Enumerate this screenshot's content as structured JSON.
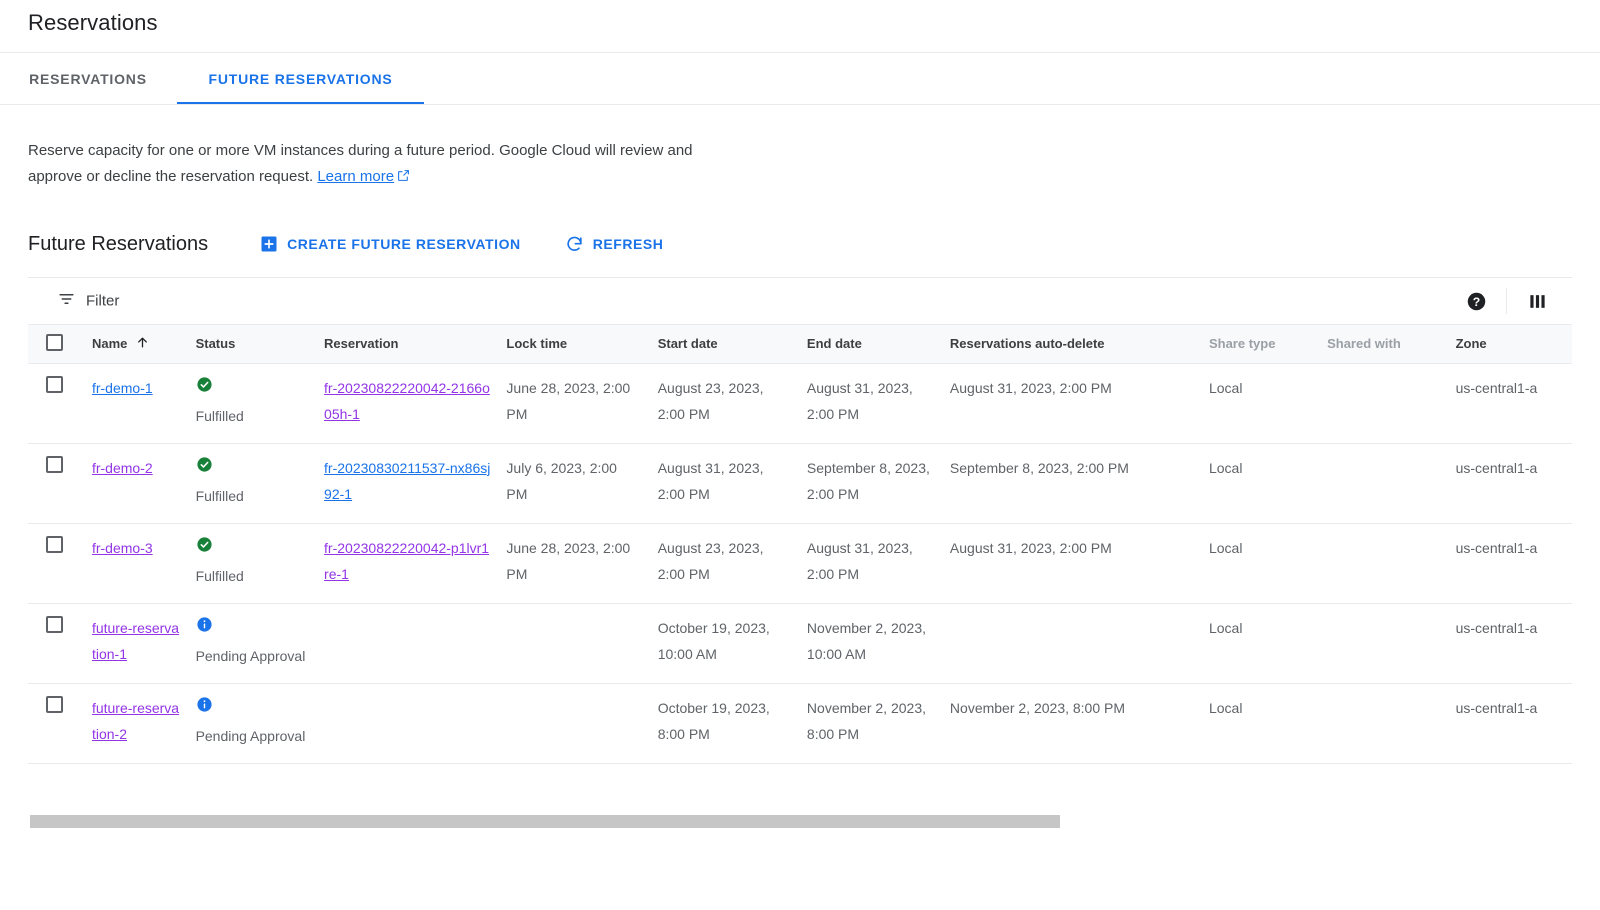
{
  "page": {
    "title": "Reservations"
  },
  "tabs": [
    {
      "label": "RESERVATIONS",
      "selected": false
    },
    {
      "label": "FUTURE RESERVATIONS",
      "selected": true
    }
  ],
  "description": {
    "text": "Reserve capacity for one or more VM instances during a future period. Google Cloud will review and approve or decline the reservation request.",
    "link_label": "Learn more",
    "link_icon": "open-in-new-icon"
  },
  "section": {
    "title": "Future Reservations",
    "create_label": "CREATE FUTURE RESERVATION",
    "create_icon": "add-box-icon",
    "refresh_label": "REFRESH",
    "refresh_icon": "refresh-icon"
  },
  "filter_bar": {
    "filter_label": "Filter",
    "filter_icon": "filter-list-icon",
    "filter_placeholder": "Filter",
    "help_icon": "help-icon",
    "columns_icon": "column-settings-icon"
  },
  "table": {
    "sort_column": "Name",
    "sort_direction": "ascending",
    "sort_icon": "arrow-up-icon",
    "select_all_checkbox": "unchecked",
    "columns": [
      {
        "key": "checkbox",
        "label": ""
      },
      {
        "key": "name",
        "label": "Name",
        "dim": false
      },
      {
        "key": "status",
        "label": "Status",
        "dim": false
      },
      {
        "key": "reservation",
        "label": "Reservation",
        "dim": false
      },
      {
        "key": "lock_time",
        "label": "Lock time",
        "dim": false
      },
      {
        "key": "start_date",
        "label": "Start date",
        "dim": false
      },
      {
        "key": "end_date",
        "label": "End date",
        "dim": false
      },
      {
        "key": "auto_delete",
        "label": "Reservations auto-delete",
        "dim": false
      },
      {
        "key": "share_type",
        "label": "Share type",
        "dim": true
      },
      {
        "key": "shared_with",
        "label": "Shared with",
        "dim": true
      },
      {
        "key": "zone",
        "label": "Zone",
        "dim": false
      }
    ],
    "rows": [
      {
        "checkbox": "unchecked",
        "name": "fr-demo-1",
        "name_color": "blue",
        "status_icon": "check-circle-icon",
        "status_icon_color": "#188038",
        "status": "Fulfilled",
        "reservation": "fr-20230822220042-2166o05h-1",
        "reservation_color": "purple",
        "lock_time": "June 28, 2023, 2:00 PM",
        "start_date": "August 23, 2023, 2:00 PM",
        "end_date": "August 31, 2023, 2:00 PM",
        "auto_delete": "August 31, 2023, 2:00 PM",
        "share_type": "Local",
        "shared_with": "",
        "zone": "us-central1-a"
      },
      {
        "checkbox": "unchecked",
        "name": "fr-demo-2",
        "name_color": "purple",
        "status_icon": "check-circle-icon",
        "status_icon_color": "#188038",
        "status": "Fulfilled",
        "reservation": "fr-20230830211537-nx86sj92-1",
        "reservation_color": "blue",
        "lock_time": "July 6, 2023, 2:00 PM",
        "start_date": "August 31, 2023, 2:00 PM",
        "end_date": "September 8, 2023, 2:00 PM",
        "auto_delete": "September 8, 2023, 2:00 PM",
        "share_type": "Local",
        "shared_with": "",
        "zone": "us-central1-a"
      },
      {
        "checkbox": "unchecked",
        "name": "fr-demo-3",
        "name_color": "purple",
        "status_icon": "check-circle-icon",
        "status_icon_color": "#188038",
        "status": "Fulfilled",
        "reservation": "fr-20230822220042-p1lvr1re-1",
        "reservation_color": "purple",
        "lock_time": "June 28, 2023, 2:00 PM",
        "start_date": "August 23, 2023, 2:00 PM",
        "end_date": "August 31, 2023, 2:00 PM",
        "auto_delete": "August 31, 2023, 2:00 PM",
        "share_type": "Local",
        "shared_with": "",
        "zone": "us-central1-a"
      },
      {
        "checkbox": "unchecked",
        "name": "future-reservation-1",
        "name_color": "purple",
        "status_icon": "info-icon",
        "status_icon_color": "#1a73e8",
        "status": "Pending Approval",
        "reservation": "",
        "reservation_color": "purple",
        "lock_time": "",
        "start_date": "October 19, 2023, 10:00 AM",
        "end_date": "November 2, 2023, 10:00 AM",
        "auto_delete": "",
        "share_type": "Local",
        "shared_with": "",
        "zone": "us-central1-a"
      },
      {
        "checkbox": "unchecked",
        "name": "future-reservation-2",
        "name_color": "purple",
        "status_icon": "info-icon",
        "status_icon_color": "#1a73e8",
        "status": "Pending Approval",
        "reservation": "",
        "reservation_color": "purple",
        "lock_time": "",
        "start_date": "October 19, 2023, 8:00 PM",
        "end_date": "November 2, 2023, 8:00 PM",
        "auto_delete": "November 2, 2023, 8:00 PM",
        "share_type": "Local",
        "shared_with": "",
        "zone": "us-central1-a"
      }
    ]
  },
  "colors": {
    "accent_blue": "#1a73e8",
    "visited_purple": "#9334e6",
    "success_green": "#188038",
    "header_bg": "#f8f9fa",
    "border": "#e8eaed",
    "text_primary": "#202124",
    "text_secondary": "#5f6368",
    "text_dim": "#9aa0a6"
  }
}
